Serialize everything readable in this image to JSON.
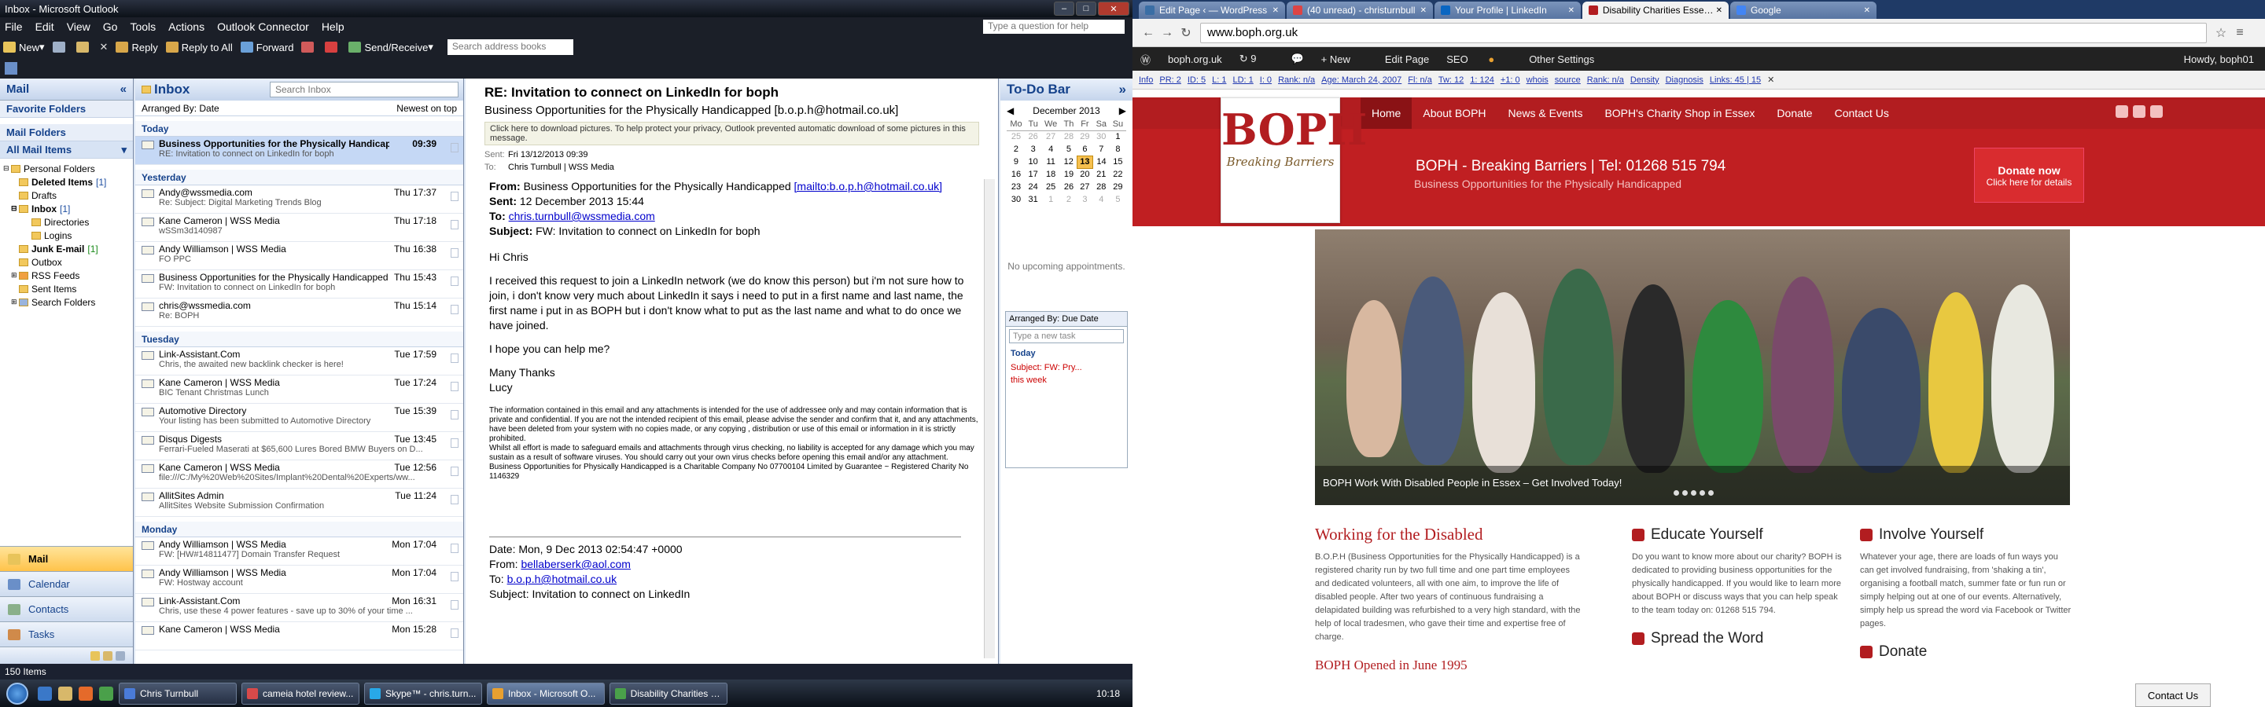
{
  "outlook": {
    "title": "Inbox - Microsoft Outlook",
    "menu": [
      "File",
      "Edit",
      "View",
      "Go",
      "Tools",
      "Actions",
      "Outlook Connector",
      "Help"
    ],
    "help_placeholder": "Type a question for help",
    "toolbar": {
      "new": "New",
      "reply": "Reply",
      "reply_all": "Reply to All",
      "forward": "Forward",
      "send_receive": "Send/Receive",
      "search_books": "Search address books"
    },
    "nav": {
      "title": "Mail",
      "favorites": "Favorite Folders",
      "mail_folders": "Mail Folders",
      "all_items": "All Mail Items",
      "folders": [
        {
          "name": "Personal Folders",
          "count": "",
          "level": 1
        },
        {
          "name": "Deleted Items",
          "count": "[1]",
          "level": 2
        },
        {
          "name": "Drafts",
          "count": "",
          "level": 2
        },
        {
          "name": "Inbox",
          "count": "[1]",
          "level": 2
        },
        {
          "name": "Directories",
          "count": "",
          "level": 3
        },
        {
          "name": "Logins",
          "count": "",
          "level": 3
        },
        {
          "name": "Junk E-mail",
          "count": "[1]",
          "level": 2
        },
        {
          "name": "Outbox",
          "count": "",
          "level": 2
        },
        {
          "name": "RSS Feeds",
          "count": "",
          "level": 2
        },
        {
          "name": "Sent Items",
          "count": "",
          "level": 2
        },
        {
          "name": "Search Folders",
          "count": "",
          "level": 2
        }
      ],
      "buttons": [
        "Mail",
        "Calendar",
        "Contacts",
        "Tasks"
      ]
    },
    "list": {
      "title": "Inbox",
      "search_placeholder": "Search Inbox",
      "arranged": "Arranged By: Date",
      "sort": "Newest on top",
      "groups": [
        {
          "name": "Today",
          "items": [
            {
              "from": "Business Opportunities for the Physically Handicapped",
              "time": "09:39",
              "subject": "RE: Invitation to connect on LinkedIn for boph",
              "bold": true
            }
          ]
        },
        {
          "name": "Yesterday",
          "items": [
            {
              "from": "Andy@wssmedia.com",
              "time": "Thu 17:37",
              "subject": "Re: Subject: Digital Marketing Trends Blog"
            },
            {
              "from": "Kane Cameron | WSS Media",
              "time": "Thu 17:18",
              "subject": "wSSm3d140987"
            },
            {
              "from": "Andy Williamson | WSS Media",
              "time": "Thu 16:38",
              "subject": "FO PPC"
            },
            {
              "from": "Business Opportunities for the Physically Handicapped",
              "time": "Thu 15:43",
              "subject": "FW: Invitation to connect on LinkedIn for boph"
            },
            {
              "from": "chris@wssmedia.com",
              "time": "Thu 15:14",
              "subject": "Re: BOPH"
            }
          ]
        },
        {
          "name": "Tuesday",
          "items": [
            {
              "from": "Link-Assistant.Com",
              "time": "Tue 17:59",
              "subject": "Chris, the awaited new backlink checker is here!"
            },
            {
              "from": "Kane Cameron | WSS Media",
              "time": "Tue 17:24",
              "subject": "BIC Tenant Christmas Lunch"
            },
            {
              "from": "Automotive Directory",
              "time": "Tue 15:39",
              "subject": "Your listing has been submitted to Automotive Directory"
            },
            {
              "from": "Disqus Digests",
              "time": "Tue 13:45",
              "subject": "Ferrari-Fueled Maserati at $65,600 Lures Bored BMW Buyers on D..."
            },
            {
              "from": "Kane Cameron | WSS Media",
              "time": "Tue 12:56",
              "subject": "file:///C:/My%20Web%20Sites/Implant%20Dental%20Experts/ww..."
            },
            {
              "from": "AllitSites Admin",
              "time": "Tue 11:24",
              "subject": "AllitSites Website Submission Confirmation"
            }
          ]
        },
        {
          "name": "Monday",
          "items": [
            {
              "from": "Andy Williamson | WSS Media",
              "time": "Mon 17:04",
              "subject": "FW: [HW#14811477] Domain Transfer Request"
            },
            {
              "from": "Andy Williamson | WSS Media",
              "time": "Mon 17:04",
              "subject": "FW: Hostway account"
            },
            {
              "from": "Link-Assistant.Com",
              "time": "Mon 16:31",
              "subject": "Chris, use these 4 power features - save up to 30% of your time ..."
            },
            {
              "from": "Kane Cameron | WSS Media",
              "time": "Mon 15:28",
              "subject": ""
            }
          ]
        }
      ]
    },
    "reading": {
      "subject": "RE: Invitation to connect on LinkedIn for boph",
      "from": "Business Opportunities for the Physically Handicapped [b.o.p.h@hotmail.co.uk]",
      "info": "Click here to download pictures. To help protect your privacy, Outlook prevented automatic download of some pictures in this message.",
      "sent_label": "Sent:",
      "sent": "Fri 13/12/2013 09:39",
      "to_label": "To:",
      "to": "Chris Turnbull | WSS Media",
      "quoted_from_label": "From:",
      "quoted_from": "Business Opportunities for the Physically Handicapped",
      "quoted_from_link": "[mailto:b.o.p.h@hotmail.co.uk]",
      "quoted_sent_label": "Sent:",
      "quoted_sent": "12 December 2013 15:44",
      "quoted_to_label": "To:",
      "quoted_to": "chris.turnbull@wssmedia.com",
      "quoted_subject_label": "Subject:",
      "quoted_subject": "FW: Invitation to connect on LinkedIn for boph",
      "greeting": "Hi Chris",
      "p1": "I received this request to join a LinkedIn network (we do know this person) but i'm not sure how to join, i don't know very much about LinkedIn it says i need to put in a first name and last name, the first name i put in as BOPH but i don't know what to put as the last name and what to do once we have joined.",
      "p2": "I hope you can help me?",
      "thanks": "Many Thanks",
      "sign": "Lucy",
      "disclaimer1": "The information contained in this email and any attachments is intended for the use of addressee only and may contain information that is private and confidential. If you are not the intended recipient of this email, please advise the sender and confirm that it, and any attachments, have been deleted from your system with no copies made, or any copying , distribution or use of this email or information in it is strictly prohibited.",
      "disclaimer2": "Whilst all effort is made to safeguard emails and attachments through virus checking, no liability is accepted for any damage which you may sustain as a result of software viruses. You should carry out your own virus checks before opening this email and/or any attachment.",
      "disclaimer3": "Business Opportunities for Physically Handicapped is a Charitable Company No 07700104 Limited by Guarantee ~ Registered Charity No 1146329",
      "date_line": "Date: Mon, 9 Dec 2013 02:54:47 +0000",
      "from2_label": "From:",
      "from2": "bellaberserk@aol.com",
      "to2_label": "To:",
      "to2": "b.o.p.h@hotmail.co.uk",
      "subject2": "Subject: Invitation to connect on LinkedIn"
    },
    "todo": {
      "title": "To-Do Bar",
      "month": "December 2013",
      "days": [
        "Mo",
        "Tu",
        "We",
        "Th",
        "Fr",
        "Sa",
        "Su"
      ],
      "weeks": [
        [
          "25",
          "26",
          "27",
          "28",
          "29",
          "30",
          "1"
        ],
        [
          "2",
          "3",
          "4",
          "5",
          "6",
          "7",
          "8"
        ],
        [
          "9",
          "10",
          "11",
          "12",
          "13",
          "14",
          "15"
        ],
        [
          "16",
          "17",
          "18",
          "19",
          "20",
          "21",
          "22"
        ],
        [
          "23",
          "24",
          "25",
          "26",
          "27",
          "28",
          "29"
        ],
        [
          "30",
          "31",
          "1",
          "2",
          "3",
          "4",
          "5"
        ]
      ],
      "today": "13",
      "no_appointments": "No upcoming appointments.",
      "arranged": "Arranged By: Due Date",
      "new_task": "Type a new task",
      "today_label": "Today",
      "task1": "Subject: FW: Pry...",
      "task2": "this week"
    },
    "status": "150 Items",
    "taskbar": {
      "tasks": [
        "Chris Turnbull",
        "cameia hotel review...",
        "Skype™ - chris.turn...",
        "Inbox - Microsoft O...",
        "Disability Charities E..."
      ],
      "clock": "10:18"
    }
  },
  "chrome": {
    "tabs": [
      "Edit Page ‹ — WordPress",
      "(40 unread) - christurnbull",
      "Your Profile | LinkedIn",
      "Disability Charities Essex &",
      "Google"
    ],
    "url": "www.boph.org.uk",
    "wp": {
      "site": "boph.org.uk",
      "updates": "9",
      "new": "New",
      "edit": "Edit Page",
      "seo": "SEO",
      "other": "Other Settings",
      "howdy": "Howdy, boph01"
    },
    "seo": [
      "Info",
      "PR: 2",
      "ID: 5",
      "L: 1",
      "LD: 1",
      "I: 0",
      "Rank: n/a",
      "Age: March 24, 2007",
      "Fl: n/a",
      "Tw: 12",
      "1: 124",
      "+1: 0",
      "whois",
      "source",
      "Rank: n/a",
      "Density",
      "Diagnosis",
      "Links: 45 | 15"
    ],
    "nav": [
      "Home",
      "About BOPH",
      "News & Events",
      "BOPH's Charity Shop in Essex",
      "Donate",
      "Contact Us"
    ],
    "logo": "BOPH",
    "logo_sub": "Breaking Barriers",
    "hero_title": "BOPH - Breaking Barriers | Tel: 01268 515 794",
    "hero_sub": "Business Opportunities for the Physically Handicapped",
    "donate": "Donate now",
    "donate_sub": "Click here for details",
    "slide_caption": "BOPH Work With Disabled People in Essex – Get Involved Today!",
    "c1_title": "Working for the Disabled",
    "c1_text": "B.O.P.H (Business Opportunities for the Physically Handicapped) is a registered charity run by two full time and one part time employees and dedicated volunteers, all with one aim, to improve the life of disabled people. After two years of continuous fundraising a delapidated building was refurbished to a very high standard, with the help of local tradesmen, who gave their time and expertise free of charge.",
    "c1_title2": "BOPH Opened in June 1995",
    "c2_title": "Educate Yourself",
    "c2_text": "Do you want to know more about our charity? BOPH is dedicated to providing business opportunities for the physically handicapped. If you would like to learn more about BOPH or discuss ways that you can help speak to the team today on: 01268 515 794.",
    "c2_title2": "Spread the Word",
    "c3_title": "Involve Yourself",
    "c3_text": "Whatever your age, there are loads of fun ways you can get involved fundraising, from 'shaking a tin', organising a football match, summer fate or fun run or simply helping out at one of our events. Alternatively, simply help us spread the word via Facebook or Twitter pages.",
    "c3_title2": "Donate",
    "contact_btn": "Contact Us"
  }
}
